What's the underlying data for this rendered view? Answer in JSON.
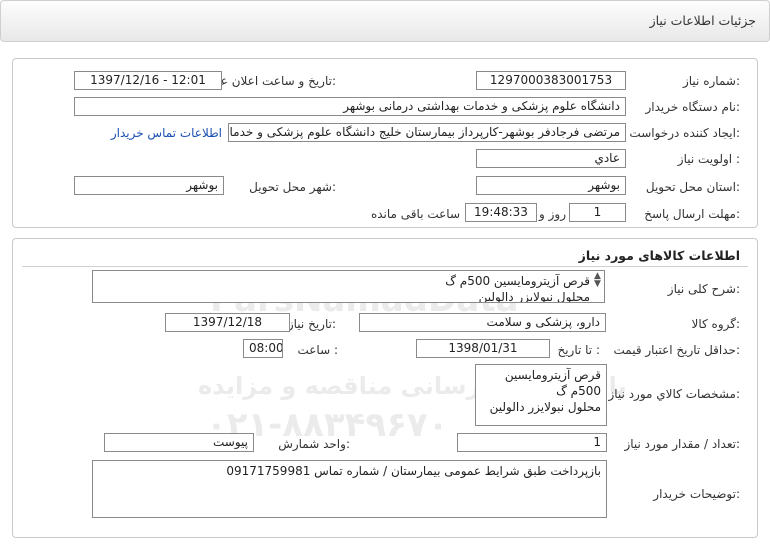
{
  "header": {
    "title": "جزئیات اطلاعات نیاز"
  },
  "need_info": {
    "need_number_label": "شماره نیاز:",
    "need_number": "1297000383001753",
    "announce_label": "تاریخ و ساعت اعلان عمومی:",
    "announce_value": "1397/12/16 - 12:01",
    "buyer_org_label": "نام دستگاه خریدار:",
    "buyer_org": "دانشگاه علوم پزشکی و خدمات بهداشتی درمانی بوشهر",
    "requester_label": "ایجاد کننده درخواست:",
    "requester": "مرتضی فرجادفر بوشهر-کارپرداز بیمارستان خلیج دانشگاه علوم پزشکی و خدمات",
    "contact_link": "اطلاعات تماس خریدار",
    "priority_label": "اولویت نیاز :",
    "priority": "عادي",
    "province_label": "استان محل تحویل:",
    "province": "بوشهر",
    "city_label": "شهر محل تحویل:",
    "city": "بوشهر",
    "deadline_label": "مهلت ارسال پاسخ:",
    "deadline_days": "1",
    "days_word": "روز و",
    "deadline_time": "19:48:33",
    "remaining_word": "ساعت باقی مانده"
  },
  "goods": {
    "section_title": "اطلاعات کالاهای مورد نیاز",
    "general_desc_label": "شرح کلی نیاز:",
    "general_desc": "قرص آزیترومایسین 500م گ\nمحلول نبولایزر دالولین",
    "goods_group_label": "گروه کالا:",
    "goods_group": "دارو، پزشکی و سلامت",
    "need_date_label": "تاریخ نیاز به کالا:",
    "need_date": "1397/12/18",
    "min_validity_label": "حداقل تاریخ اعتبار قیمت:",
    "until_date_label": "تا تاریخ :",
    "until_date": "1398/01/31",
    "time_label": "ساعت :",
    "time_value": "08:00",
    "specs_label": "مشخصات کالاي مورد نیاز:",
    "specs": "قرص آزیترومایسین 500م گ\nمحلول نبولایزر دالولین\n\nادامه طبق مدارک پیوست",
    "quantity_label": "تعداد / مقدار مورد نیاز:",
    "quantity": "1",
    "unit_label": "واحد شمارش:",
    "unit": "پیوست",
    "buyer_notes_label": "توضیحات خریدار:",
    "buyer_notes": "بازپرداخت طبق شرایط عمومی بیمارستان / شماره تماس 09171759981"
  },
  "watermark": {
    "logo_text": "ParsNamadData",
    "line1": "پایگاه اطلاع رسانی مناقصه و مزایده",
    "phone": "۰۲۱-۸۸۳۴۹۶۷۰"
  }
}
